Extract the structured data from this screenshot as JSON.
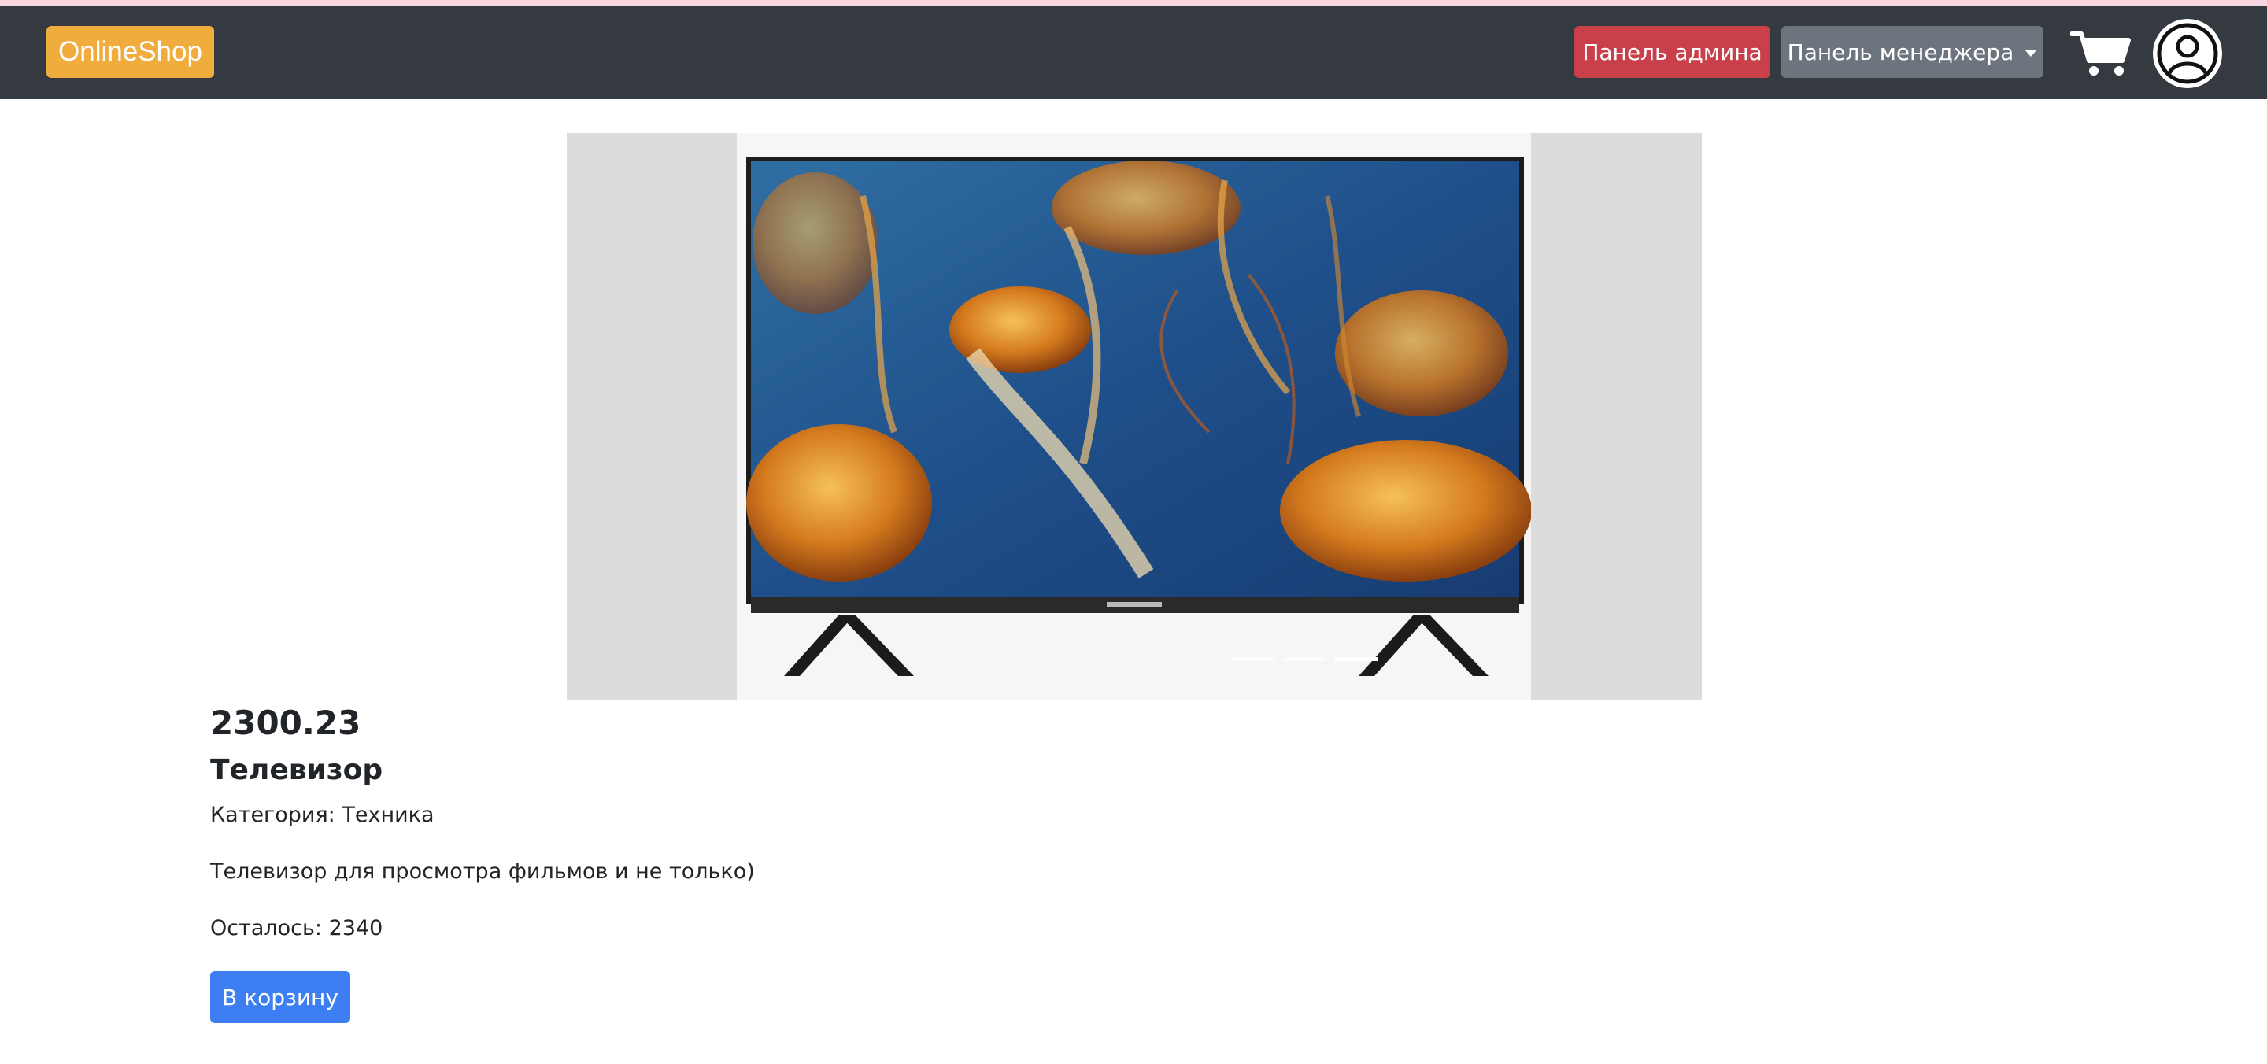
{
  "navbar": {
    "brand": "OnlineShop",
    "admin_button": "Панель админа",
    "manager_button": "Панель менеджера"
  },
  "carousel": {
    "slides": 3,
    "active_index": 2
  },
  "product": {
    "price": "2300.23",
    "name": "Телевизор",
    "category_line": "Категория: Техника",
    "description": "Телевизор для просмотра фильмов и не только)",
    "stock_line": "Осталось: 2340",
    "add_to_cart_label": "В корзину"
  },
  "icons": {
    "cart": "cart-icon",
    "profile": "user-circle-icon",
    "dropdown": "caret-down-icon"
  },
  "colors": {
    "navbar_bg": "#343a40",
    "brand_bg": "#f0ad3e",
    "admin_btn": "#c9404a",
    "manager_btn": "#6c757d",
    "cart_btn": "#3d7ef2"
  }
}
